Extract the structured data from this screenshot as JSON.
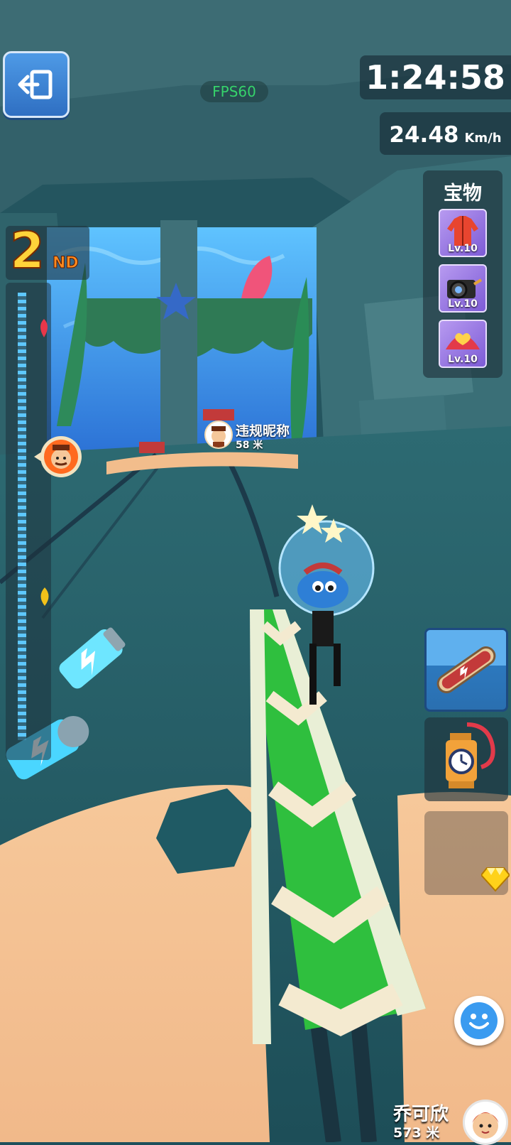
{
  "hud": {
    "fps": "FPS60",
    "timer": "1:24:58",
    "speed_value": "24.48",
    "speed_unit": "Km/h",
    "rank_number": "2",
    "rank_suffix": "ND"
  },
  "treasure": {
    "title": "宝物",
    "items": [
      {
        "icon": "jacket-icon",
        "level": "Lv.10"
      },
      {
        "icon": "camera-icon",
        "level": "Lv.10"
      },
      {
        "icon": "heart-fan-icon",
        "level": "Lv.10"
      }
    ]
  },
  "race": {
    "progress_player_fraction": 0.92,
    "progress_opponent_fraction": 0.32
  },
  "opponent": {
    "name": "违规昵称",
    "distance": "58 米"
  },
  "player": {
    "name": "乔可欣",
    "distance": "573 米"
  },
  "items": {
    "slot1": "skateboard-icon",
    "slot2": "lantern-clock-icon",
    "slot3": "empty"
  },
  "colors": {
    "track_green": "#2fbf3e",
    "track_cream": "#f4ead0",
    "sand": "#f2c090",
    "exit_blue": "#3b82d6"
  }
}
